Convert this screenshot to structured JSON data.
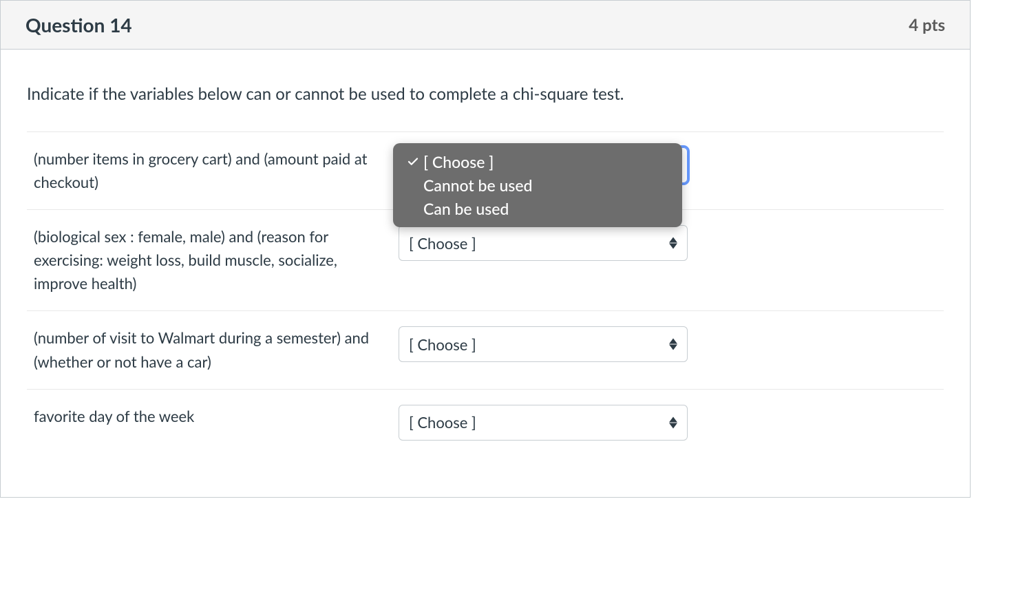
{
  "header": {
    "title": "Question 14",
    "points": "4 pts"
  },
  "prompt": "Indicate if the variables below can or cannot be used to complete a chi-square test.",
  "select_placeholder": "[ Choose ]",
  "dropdown": {
    "options": [
      {
        "label": "[ Choose ]",
        "checked": true
      },
      {
        "label": "Cannot be used",
        "checked": false
      },
      {
        "label": "Can be used",
        "checked": false
      }
    ]
  },
  "rows": [
    {
      "label": "(number items in grocery cart) and (amount paid at checkout)"
    },
    {
      "label": "(biological sex : female, male) and (reason for exercising: weight loss, build muscle, socialize, improve health)"
    },
    {
      "label": "(number of visit to Walmart during a semester) and (whether or not have a car)"
    },
    {
      "label": "favorite day of the week"
    }
  ]
}
